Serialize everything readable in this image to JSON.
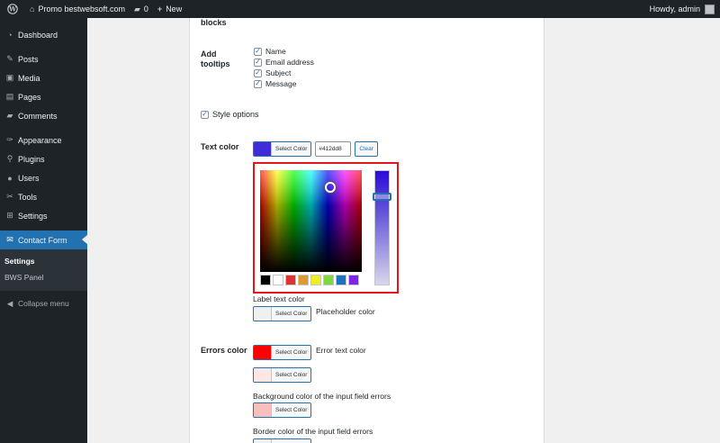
{
  "adminbar": {
    "site_name": "Promo bestwebsoft.com",
    "comments_count": "0",
    "new_label": "New",
    "greeting": "Howdy, admin"
  },
  "sidebar": {
    "items": [
      {
        "label": "Dashboard",
        "icon": "dashboard-icon"
      },
      {
        "label": "Posts",
        "icon": "pin-icon"
      },
      {
        "label": "Media",
        "icon": "media-icon"
      },
      {
        "label": "Pages",
        "icon": "pages-icon"
      },
      {
        "label": "Comments",
        "icon": "comments-icon"
      },
      {
        "label": "Appearance",
        "icon": "appearance-icon"
      },
      {
        "label": "Plugins",
        "icon": "plugins-icon"
      },
      {
        "label": "Users",
        "icon": "users-icon"
      },
      {
        "label": "Tools",
        "icon": "tools-icon"
      },
      {
        "label": "Settings",
        "icon": "settings-icon"
      },
      {
        "label": "Contact Form",
        "icon": "mail-icon"
      }
    ],
    "submenu": [
      "Settings",
      "BWS Panel"
    ],
    "collapse_label": "Collapse menu"
  },
  "form": {
    "blocks_label": "blocks",
    "tooltips_label_line1": "Add",
    "tooltips_label_line2": "tooltips",
    "tooltips": [
      {
        "label": "Name",
        "checked": true
      },
      {
        "label": "Email address",
        "checked": true
      },
      {
        "label": "Subject",
        "checked": true
      },
      {
        "label": "Message",
        "checked": true
      }
    ],
    "style_options_label": "Style options",
    "text_color_label": "Text color",
    "select_color_label": "Select Color",
    "text_color_hex": "#412dd8",
    "clear_label": "Clear",
    "label_text_color": "Label text color",
    "placeholder_color": "Placeholder color",
    "errors_color_label": "Errors color",
    "error_text_color": "Error text color",
    "bg_errors_label": "Background color of the input field errors",
    "border_errors_label": "Border color of the input field errors"
  },
  "colors": {
    "text_color_swatch": "#412dd8",
    "label_swatch": "#f0f0f1",
    "error_swatch": "#ff0000",
    "error_bg_swatch": "#fde7e5",
    "error_border_swatch": "#f7c0bd",
    "palette": [
      "#000000",
      "#ffffff",
      "#dd3333",
      "#dd9933",
      "#eeee22",
      "#81d742",
      "#1e73be",
      "#8224e3"
    ]
  }
}
